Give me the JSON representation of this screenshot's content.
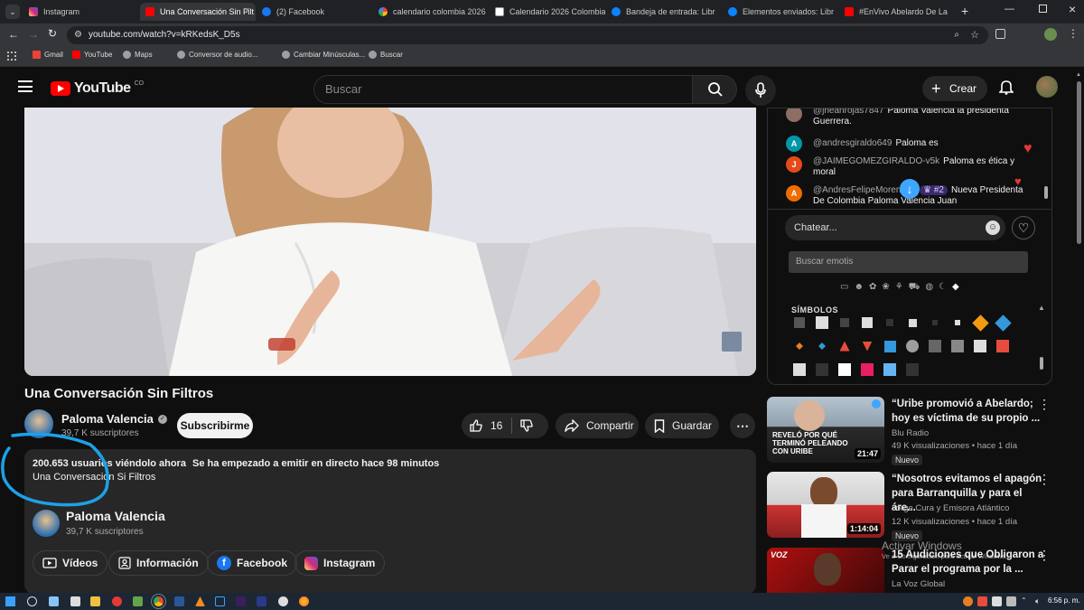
{
  "browser": {
    "tabs": [
      {
        "label": "Instagram",
        "color": "#d62976"
      },
      {
        "label": "Una Conversación Sin Filt",
        "color": "#ff0000"
      },
      {
        "label": "(2) Facebook",
        "color": "#1877f2"
      },
      {
        "label": "calendario colombia 2026",
        "color": "#4285f4"
      },
      {
        "label": "Calendario 2026 Colombia",
        "color": "#ffffff"
      },
      {
        "label": "Bandeja de entrada: Libr",
        "color": "#0a84ff"
      },
      {
        "label": "Elementos enviados: Libr",
        "color": "#0a84ff"
      },
      {
        "label": "#EnVivo Abelardo De La",
        "color": "#ff0000"
      }
    ],
    "url": "youtube.com/watch?v=kRKedsK_D5s",
    "bookmarks": [
      "Gmail",
      "YouTube",
      "Maps",
      "Conversor de audio...",
      "Cambiar Minúsculas...",
      "Buscar"
    ]
  },
  "header": {
    "logo_text": "YouTube",
    "country": "CO",
    "search_placeholder": "Buscar",
    "create_label": "Crear"
  },
  "video": {
    "title": "Una Conversación Sin Filtros",
    "channel": "Paloma Valencia",
    "subscribers": "39,7 K suscriptores",
    "subscribe_label": "Subscribirme",
    "likes": "16",
    "share_label": "Compartir",
    "save_label": "Guardar"
  },
  "description": {
    "viewers": "200.653 usuarios viéndolo ahora",
    "started": "Se ha empezado a emitir en directo hace 98 minutos",
    "subtitle": "Una Conversación Si Filtros",
    "channel": "Paloma Valencia",
    "subscribers": "39,7 K suscriptores",
    "chips": [
      "Vídeos",
      "Información",
      "Facebook",
      "Instagram"
    ]
  },
  "chat": {
    "messages": [
      {
        "author": "@jheanrojas7847",
        "text": "Paloma Valencia la presidenta Guerrera.",
        "avatar": "",
        "color": "#8d6e63"
      },
      {
        "author": "@andresgiraldo649",
        "text": "Paloma es",
        "avatar": "A",
        "color": "#0097a7"
      },
      {
        "author": "@JAIMEGOMEZGIRALDO-v5k",
        "text": "Paloma es ética y moral",
        "avatar": "J",
        "color": "#e64a19"
      },
      {
        "author": "@AndresFelipeMoren...m",
        "text": "Nueva Presidenta De Colombia Paloma Valencia Juan",
        "avatar": "A",
        "color": "#ef6c00",
        "rank": "#2"
      }
    ],
    "input_placeholder": "Chatear...",
    "emoji_search_placeholder": "Buscar emotis",
    "emoji_section": "SÍMBOLOS"
  },
  "recommendations": [
    {
      "title": "“Uribe promovió a Abelardo; hoy es víctima de su propio ...",
      "channel": "Blu Radio",
      "meta": "49 K visualizaciones • hace 1 día",
      "badge": "Nuevo",
      "duration": "21:47",
      "thumb_text": "REVELÓ POR QUÉ TERMINÓ PELEANDO CON URIBE"
    },
    {
      "title": "“Nosotros evitamos el apagón para Barranquilla y para el áre...",
      "channel": "Jorge Cura y Emisora Atlántico",
      "meta": "12 K visualizaciones • hace 1 día",
      "badge": "Nuevo",
      "duration": "1:14:04",
      "thumb_text": ""
    },
    {
      "title": "15 Audiciones que Obligaron a Parar el programa por la ...",
      "channel": "La Voz Global",
      "meta": "",
      "badge": "",
      "duration": "",
      "thumb_text": ""
    }
  ],
  "watermark": {
    "line1": "Activar Windows",
    "line2": "Ve a Configuración para activar Windows."
  },
  "taskbar": {
    "time": "6:56 p. m."
  }
}
